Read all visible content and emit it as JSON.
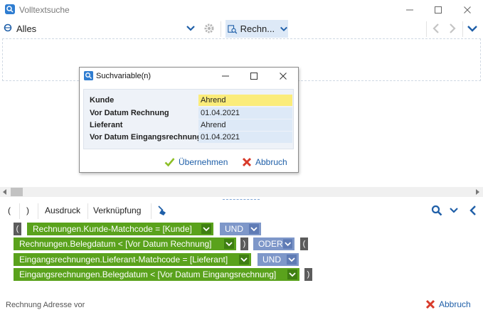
{
  "window": {
    "title": "Volltextsuche",
    "minimize_label": "—",
    "maximize_label": "☐",
    "close_label": "✕"
  },
  "toolbar": {
    "scope_label": "Alles",
    "search_entity_label": "Rechn..."
  },
  "dialog": {
    "title": "Suchvariable(n)",
    "rows": [
      {
        "label": "Kunde",
        "value": "Ahrend"
      },
      {
        "label": "Vor Datum Rechnung",
        "value": "01.04.2021"
      },
      {
        "label": "Lieferant",
        "value": "Ahrend"
      },
      {
        "label": "Vor Datum Eingangsrechnung",
        "value": "01.04.2021"
      }
    ],
    "apply_label": "Übernehmen",
    "cancel_label": "Abbruch"
  },
  "expression_toolbar": {
    "open_paren": "(",
    "close_paren": ")",
    "expression_label": "Ausdruck",
    "link_label": "Verknüpfung"
  },
  "expression": {
    "open_paren": "(",
    "close_paren": ")",
    "conditions": [
      "Rechnungen.Kunde-Matchcode = [Kunde]",
      "Rechnungen.Belegdatum < [Vor Datum Rechnung]",
      "Eingangsrechnungen.Lieferant-Matchcode = [Lieferant]",
      "Eingangsrechnungen.Belegdatum < [Vor Datum Eingangsrechnung]"
    ],
    "operators": [
      "UND",
      "ODER",
      "UND"
    ]
  },
  "status": {
    "text": "Rechnung Adresse vor"
  },
  "footer": {
    "cancel_label": "Abbruch"
  },
  "colors": {
    "accent": "#1f5fa8",
    "condition": "#5aa21c",
    "operator": "#7e97c9",
    "highlight": "#fbec7a",
    "cancel_x": "#d83a2a",
    "check": "#8cbf26"
  }
}
